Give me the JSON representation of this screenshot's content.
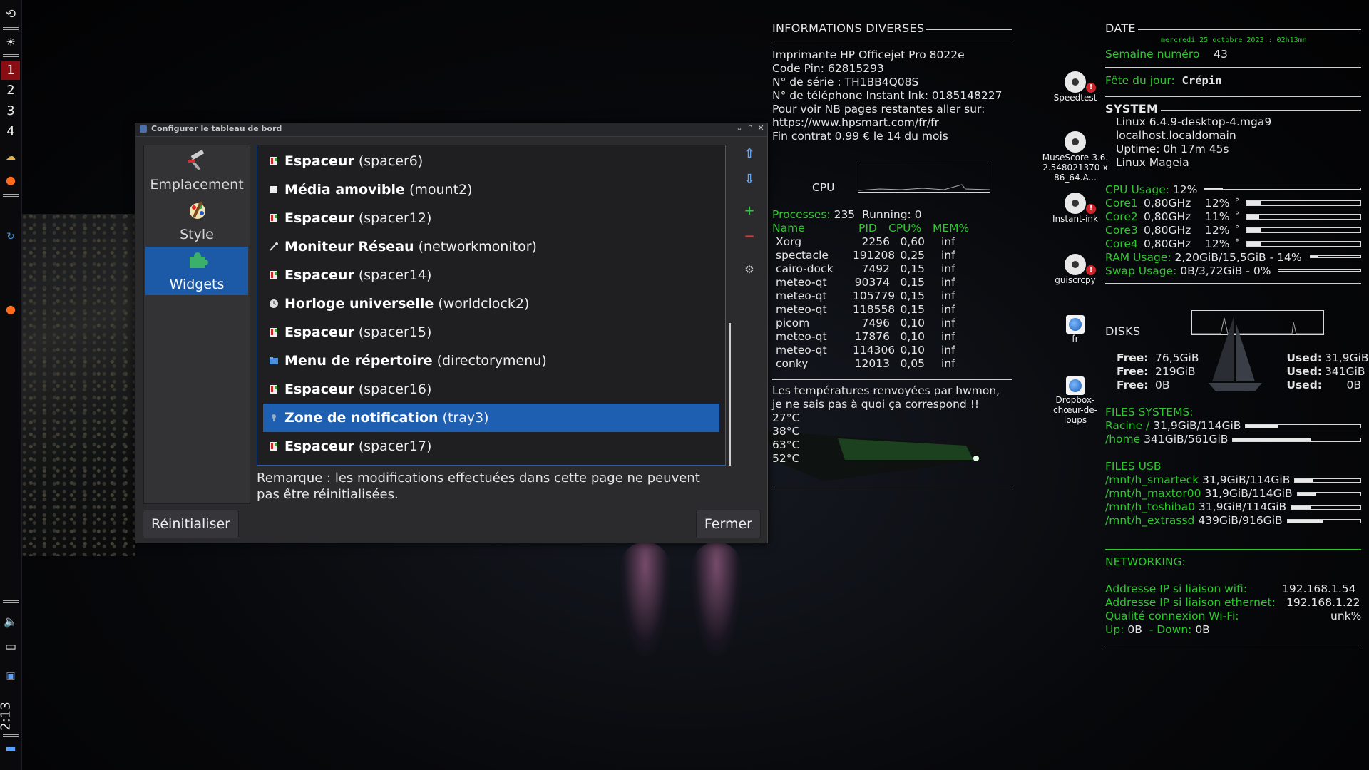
{
  "panel": {
    "desktops": [
      "1",
      "2",
      "3",
      "4"
    ],
    "clock": "2:13"
  },
  "dialog": {
    "title": "Configurer le tableau de bord",
    "sidebar": [
      {
        "label": "Emplacement"
      },
      {
        "label": "Style"
      },
      {
        "label": "Widgets"
      }
    ],
    "widgets": [
      {
        "name": "Espaceur",
        "id": "(spacer6)"
      },
      {
        "name": "Média amovible",
        "id": "(mount2)"
      },
      {
        "name": "Espaceur",
        "id": "(spacer12)"
      },
      {
        "name": "Moniteur Réseau",
        "id": "(networkmonitor)"
      },
      {
        "name": "Espaceur",
        "id": "(spacer14)"
      },
      {
        "name": "Horloge universelle",
        "id": "(worldclock2)"
      },
      {
        "name": "Espaceur",
        "id": "(spacer15)"
      },
      {
        "name": "Menu de répertoire",
        "id": "(directorymenu)"
      },
      {
        "name": "Espaceur",
        "id": "(spacer16)"
      },
      {
        "name": "Zone de notification",
        "id": "(tray3)"
      },
      {
        "name": "Espaceur",
        "id": "(spacer17)"
      }
    ],
    "note": "Remarque : les modifications effectuées dans cette page ne peuvent pas être réinitialisées.",
    "reset_label": "Réinitialiser",
    "close_label": "Fermer"
  },
  "info": {
    "header": "INFORMATIONS DIVERSES",
    "lines": [
      "Imprimante HP Officejet Pro 8022e",
      "Code Pin:      62815293",
      "N° de série :  TH1BB4Q08S",
      "N° de téléphone Instant Ink: 0185148227",
      "Pour voir NB pages restantes aller sur:",
      "https://www.hpsmart.com/fr/fr",
      "Fin contrat 0.99 € le 14 du mois"
    ],
    "cpu_label": "CPU",
    "processes_label": "Processes:",
    "processes": "235",
    "running_label": "Running:",
    "running": "0",
    "proc_headers": [
      "Name",
      "PID",
      "CPU%",
      "MEM%"
    ],
    "procs": [
      {
        "name": "Xorg",
        "pid": "2256",
        "cpu": "0,60",
        "mem": "inf"
      },
      {
        "name": "spectacle",
        "pid": "191208",
        "cpu": "0,25",
        "mem": "inf"
      },
      {
        "name": "cairo-dock",
        "pid": "7492",
        "cpu": "0,15",
        "mem": "inf"
      },
      {
        "name": "meteo-qt",
        "pid": "90374",
        "cpu": "0,15",
        "mem": "inf"
      },
      {
        "name": "meteo-qt",
        "pid": "105779",
        "cpu": "0,15",
        "mem": "inf"
      },
      {
        "name": "meteo-qt",
        "pid": "118558",
        "cpu": "0,15",
        "mem": "inf"
      },
      {
        "name": "picom",
        "pid": "7496",
        "cpu": "0,10",
        "mem": "inf"
      },
      {
        "name": "meteo-qt",
        "pid": "17876",
        "cpu": "0,10",
        "mem": "inf"
      },
      {
        "name": "meteo-qt",
        "pid": "114306",
        "cpu": "0,10",
        "mem": "inf"
      },
      {
        "name": "conky",
        "pid": "12013",
        "cpu": "0,05",
        "mem": "inf"
      }
    ],
    "temp_text1": "Les températures renvoyées par hwmon,",
    "temp_text2": "je ne sais pas à quoi ça correspond !!",
    "temps": [
      "27°C",
      "38°C",
      "63°C",
      "52°C"
    ]
  },
  "date": {
    "header": "DATE",
    "datetime": "mercredi 25 octobre 2023 : 02h13mn",
    "week_label": "Semaine numéro",
    "week": "43",
    "feast_label": "Fête du jour:",
    "feast": "Crépin"
  },
  "system": {
    "header": "SYSTEM",
    "lines": [
      "Linux 6.4.9-desktop-4.mga9",
      "localhost.localdomain",
      "Uptime: 0h 17m 45s",
      "Linux Mageia"
    ],
    "cpu_usage_label": "CPU Usage:",
    "cpu_usage": "12%",
    "cpu_usage_pct": 12,
    "cores": [
      {
        "label": "Core1",
        "freq": "0,80GHz",
        "pct": "12%",
        "deg": "°",
        "val": 12
      },
      {
        "label": "Core2",
        "freq": "0,80GHz",
        "pct": "11%",
        "deg": "°",
        "val": 11
      },
      {
        "label": "Core3",
        "freq": "0,80GHz",
        "pct": "12%",
        "deg": "°",
        "val": 12
      },
      {
        "label": "Core4",
        "freq": "0,80GHz",
        "pct": "12%",
        "deg": "°",
        "val": 12
      }
    ],
    "ram_label": "RAM Usage:",
    "ram": "2,20GiB/15,5GiB - 14%",
    "ram_pct": 14,
    "swap_label": "Swap Usage:",
    "swap": "0B/3,72GiB - 0%",
    "swap_pct": 0
  },
  "disks": {
    "header": "DISKS",
    "rows": [
      {
        "free_label": "Free:",
        "free": "76,5GiB",
        "used_label": "Used:",
        "used": "31,9GiB"
      },
      {
        "free_label": "Free:",
        "free": "219GiB",
        "used_label": "Used:",
        "used": "341GiB"
      },
      {
        "free_label": "Free:",
        "free": "0B",
        "used_label": "Used:",
        "used": "0B"
      }
    ],
    "fs_header": "FILES SYSTEMS:",
    "fs": [
      {
        "mount": "Racine /",
        "value": "31,9GiB/114GiB",
        "pct": 28
      },
      {
        "mount": "/home",
        "value": "341GiB/561GiB",
        "pct": 61
      }
    ],
    "usb_header": "FILES USB",
    "usb": [
      {
        "mount": "/mnt/h_smarteck",
        "value": "31,9GiB/114GiB",
        "pct": 28
      },
      {
        "mount": "/mnt/h_maxtor00",
        "value": "31,9GiB/114GiB",
        "pct": 28
      },
      {
        "mount": "/mnt/h_toshiba0",
        "value": "31,9GiB/114GiB",
        "pct": 28
      },
      {
        "mount": "/mnt/h_extrassd",
        "value": "439GiB/916GiB",
        "pct": 48
      }
    ]
  },
  "network": {
    "header": "NETWORKING:",
    "wifi_label": "Addresse IP si liaison wifi:",
    "wifi": "192.168.1.54",
    "eth_label": "Addresse IP si liaison ethernet:",
    "eth": "192.168.1.22",
    "quality_label": "Qualité connexion Wi-Fi:",
    "quality": "unk%",
    "up_label": "Up:",
    "up": "0B",
    "down_label": "- Down:",
    "down": "0B"
  },
  "desktop_icons": [
    {
      "label": "Speedtest"
    },
    {
      "label": "MuseScore-3.6.2.548021370-x86_64.A..."
    },
    {
      "label": "Instant-ink"
    },
    {
      "label": "guiscrcpy"
    },
    {
      "label": "fr"
    },
    {
      "label": "Dropbox-chœur-de-loups"
    }
  ],
  "colors": {
    "accent": "#1f5fb1",
    "conky_green": "#2ec82e",
    "active_desktop": "#8b0d14"
  }
}
